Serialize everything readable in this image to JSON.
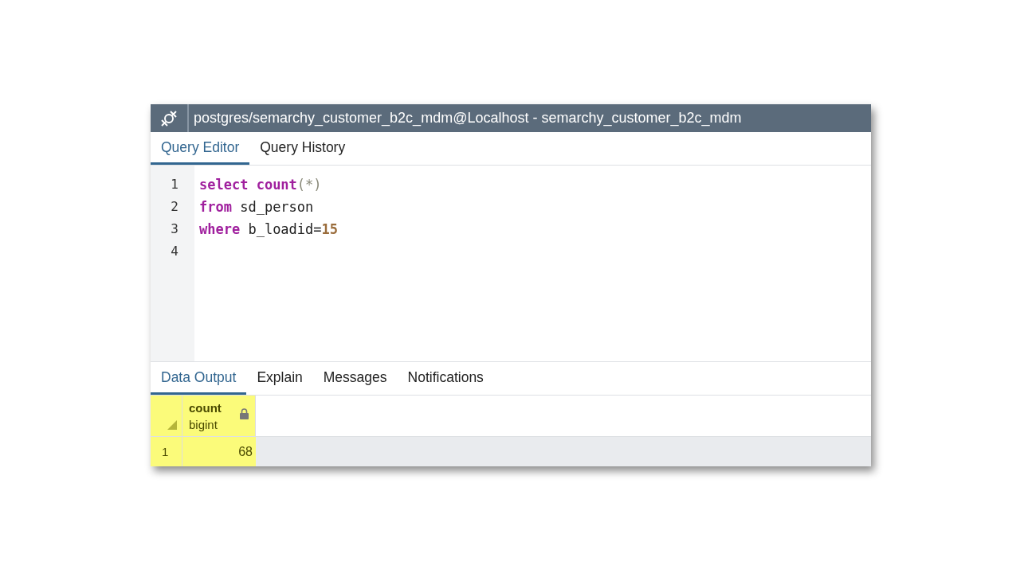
{
  "window": {
    "title": "postgres/semarchy_customer_b2c_mdm@Localhost - semarchy_customer_b2c_mdm"
  },
  "editor_tabs": [
    {
      "label": "Query Editor",
      "selected": true
    },
    {
      "label": "Query History",
      "selected": false
    }
  ],
  "code_lines": [
    {
      "number": "1",
      "tokens": [
        {
          "kind": "keyword",
          "text": "select"
        },
        {
          "kind": "keyword",
          "text": " count"
        },
        {
          "kind": "punct",
          "text": "(*)"
        }
      ]
    },
    {
      "number": "2",
      "tokens": [
        {
          "kind": "keyword",
          "text": "from"
        },
        {
          "kind": "plain",
          "text": " sd_person"
        }
      ]
    },
    {
      "number": "3",
      "tokens": [
        {
          "kind": "keyword",
          "text": "where"
        },
        {
          "kind": "plain",
          "text": " b_loadid="
        },
        {
          "kind": "number",
          "text": "15"
        }
      ]
    },
    {
      "number": "4"
    }
  ],
  "output_tabs": [
    {
      "label": "Data Output",
      "selected": true
    },
    {
      "label": "Explain",
      "selected": false
    },
    {
      "label": "Messages",
      "selected": false
    },
    {
      "label": "Notifications",
      "selected": false
    }
  ],
  "result_grid": {
    "highlighted": true,
    "columns": [
      {
        "name": "count",
        "type": "bigint"
      }
    ],
    "rows": [
      {
        "number": "1",
        "cells": [
          "68"
        ]
      }
    ]
  }
}
